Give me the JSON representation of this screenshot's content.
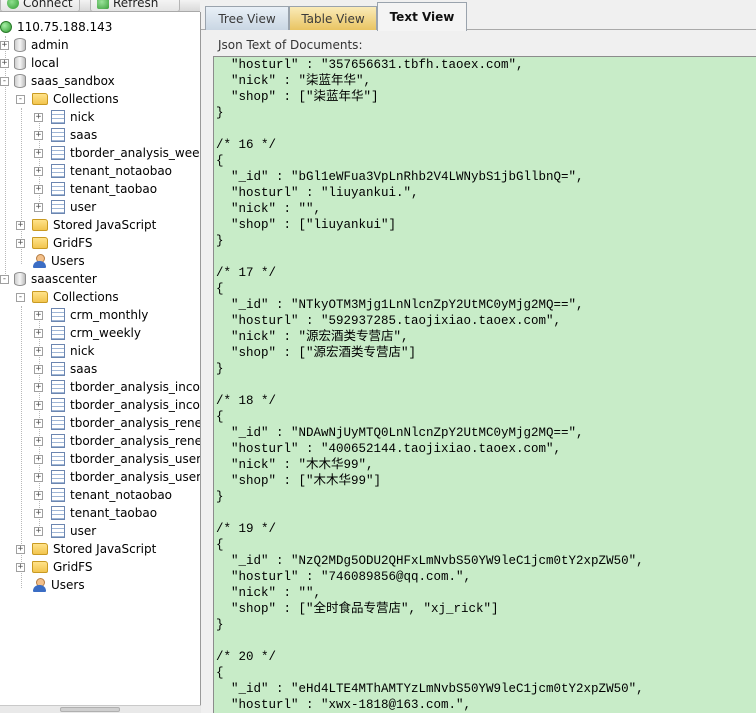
{
  "toolbar": {
    "connect_label": "Connect",
    "refresh_label": "Refresh"
  },
  "tree": {
    "server": "110.75.188.143",
    "databases": [
      {
        "name": "admin"
      },
      {
        "name": "local"
      },
      {
        "name": "saas_sandbox",
        "collections_label": "Collections",
        "collections": [
          "nick",
          "saas",
          "tborder_analysis_weekly",
          "tenant_notaobao",
          "tenant_taobao",
          "user"
        ],
        "stored_js_label": "Stored JavaScript",
        "gridfs_label": "GridFS",
        "users_label": "Users"
      },
      {
        "name": "saascenter",
        "collections_label": "Collections",
        "collections": [
          "crm_monthly",
          "crm_weekly",
          "nick",
          "saas",
          "tborder_analysis_income",
          "tborder_analysis_income",
          "tborder_analysis_renewa",
          "tborder_analysis_renewa",
          "tborder_analysis_user_m",
          "tborder_analysis_user_we",
          "tenant_notaobao",
          "tenant_taobao",
          "user"
        ],
        "stored_js_label": "Stored JavaScript",
        "gridfs_label": "GridFS",
        "users_label": "Users"
      }
    ]
  },
  "tabs": {
    "tree_view": "Tree View",
    "table_view": "Table View",
    "text_view": "Text View",
    "active": "Text View"
  },
  "editor": {
    "label": "Json Text of Documents:",
    "lines": [
      "  \"hosturl\" : \"357656631.tbfh.taoex.com\",",
      "  \"nick\" : \"柒蓝年华\",",
      "  \"shop\" : [\"柒蓝年华\"]",
      "}",
      "",
      "/* 16 */",
      "{",
      "  \"_id\" : \"bGl1eWFua3VpLnRhb2V4LWNybS1jbGllbnQ=\",",
      "  \"hosturl\" : \"liuyankui.\",",
      "  \"nick\" : \"\",",
      "  \"shop\" : [\"liuyankui\"]",
      "}",
      "",
      "/* 17 */",
      "{",
      "  \"_id\" : \"NTkyOTM3Mjg1LnNlcnZpY2UtMC0yMjg2MQ==\",",
      "  \"hosturl\" : \"592937285.taojixiao.taoex.com\",",
      "  \"nick\" : \"源宏酒类专营店\",",
      "  \"shop\" : [\"源宏酒类专营店\"]",
      "}",
      "",
      "/* 18 */",
      "{",
      "  \"_id\" : \"NDAwNjUyMTQ0LnNlcnZpY2UtMC0yMjg2MQ==\",",
      "  \"hosturl\" : \"400652144.taojixiao.taoex.com\",",
      "  \"nick\" : \"木木华99\",",
      "  \"shop\" : [\"木木华99\"]",
      "}",
      "",
      "/* 19 */",
      "{",
      "  \"_id\" : \"NzQ2MDg5ODU2QHFxLmNvbS50YW9leC1jcm0tY2xpZW50\",",
      "  \"hosturl\" : \"746089856@qq.com.\",",
      "  \"nick\" : \"\",",
      "  \"shop\" : [\"全时食品专营店\", \"xj_rick\"]",
      "}",
      "",
      "/* 20 */",
      "{",
      "  \"_id\" : \"eHd4LTE4MThAMTYzLmNvbS50YW9leC1jcm0tY2xpZW50\",",
      "  \"hosturl\" : \"xwx-1818@163.com.\","
    ]
  }
}
